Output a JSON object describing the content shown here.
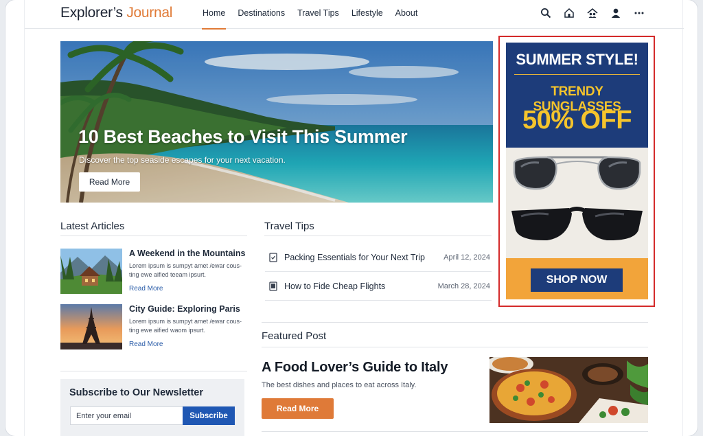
{
  "header": {
    "logo_part1": "Explorer’s",
    "logo_part2": "Journal",
    "nav": [
      "Home",
      "Destinations",
      "Travel Tips",
      "Lifestyle",
      "About"
    ],
    "icons": [
      "search-icon",
      "home-icon",
      "community-icon",
      "user-icon",
      "more-icon"
    ]
  },
  "hero": {
    "title": "10 Best Beaches to Visit This Summer",
    "subtitle": "Discover the top seaside escapes for your next vacation.",
    "button": "Read More"
  },
  "ad": {
    "line1": "SUMMER STYLE!",
    "line2": "TRENDY SUNGLASSES",
    "line3": "50% OFF",
    "button": "SHOP NOW"
  },
  "latest": {
    "heading": "Latest Articles",
    "items": [
      {
        "title": "A Weekend in the Mountains",
        "desc": "Lorem ipsum is sumpyt amet /ewar cous-ting ewe aified teeam ipsurt.",
        "link": "Read More"
      },
      {
        "title": "City Guide: Exploring Paris",
        "desc": "Lorem ipsum is sumpyt amet /ewar cous-ting ewe aified waom ipsurt.",
        "link": "Read More"
      }
    ]
  },
  "tips": {
    "heading": "Travel Tips",
    "items": [
      {
        "title": "Packing Essentials for Your Next Trip",
        "date": "April 12, 2024"
      },
      {
        "title": "How to Fide Cheap Flights",
        "date": "March 28, 2024"
      }
    ]
  },
  "featured": {
    "heading": "Featured Post",
    "title": "A Food Lover’s Guide to Italy",
    "subtitle": "The best dishes and places to eat across Italy.",
    "button": "Read More"
  },
  "newsletter": {
    "heading": "Subscribe to Our Newsletter",
    "placeholder": "Enter your email",
    "button": "Subscribe"
  },
  "colors": {
    "accent": "#e07a36",
    "ad_navy": "#1d3c7a",
    "ad_yellow": "#f5c42c",
    "link_blue": "#2a5ca8",
    "ad_border": "#d42a2a"
  }
}
